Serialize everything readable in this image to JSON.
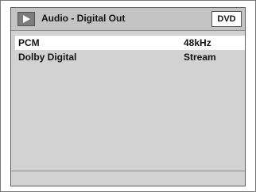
{
  "header": {
    "title": "Audio - Digital Out",
    "icon": "play-icon",
    "badge": "DVD"
  },
  "settings": [
    {
      "label": "PCM",
      "value": "48kHz",
      "selected": true
    },
    {
      "label": "Dolby Digital",
      "value": "Stream",
      "selected": false
    }
  ],
  "colors": {
    "panel": "#d2d2d2",
    "title_bar": "#c4c4c4",
    "selected_row": "#ffffff"
  }
}
